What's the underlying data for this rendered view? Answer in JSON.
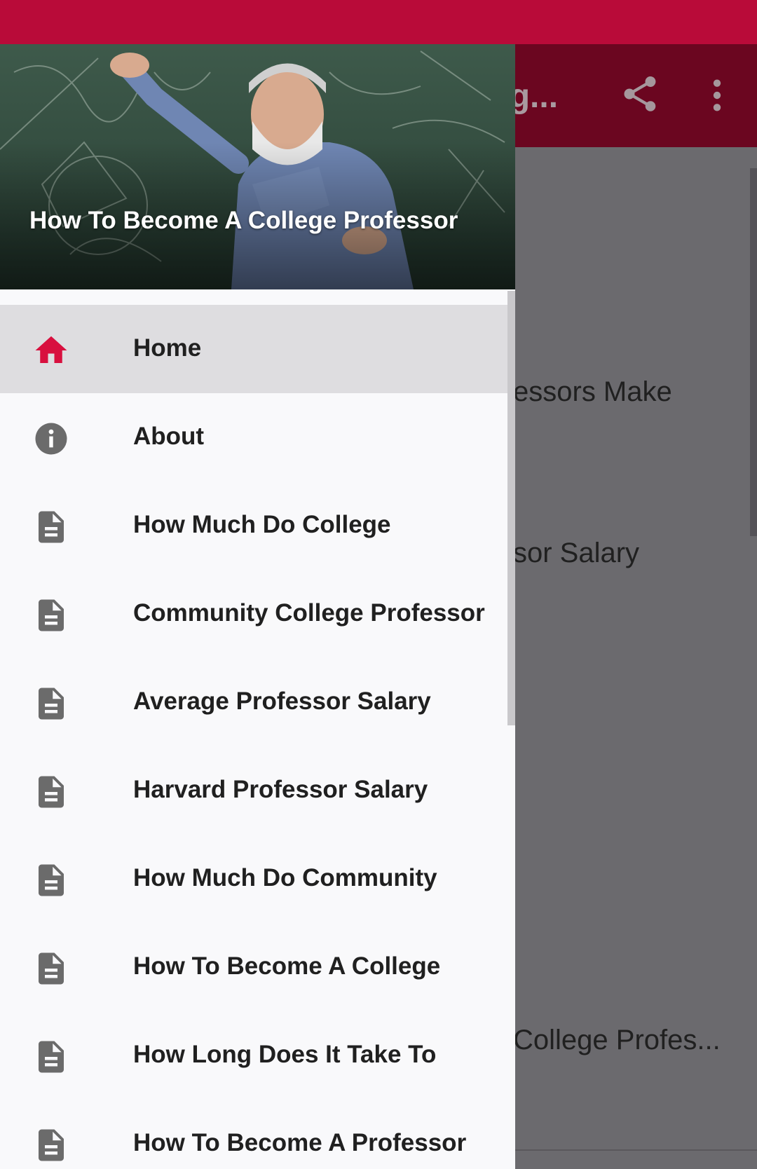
{
  "app_bar": {
    "title": "eg...",
    "icons": [
      "share-icon",
      "more-vert-icon"
    ]
  },
  "background_content": {
    "items": [
      "essors Make",
      "sor Salary",
      "College Profes..."
    ]
  },
  "drawer": {
    "header_title": "How To Become A College Professor",
    "items": [
      {
        "label": "Home",
        "icon": "home-icon",
        "selected": true
      },
      {
        "label": "About",
        "icon": "info-icon"
      },
      {
        "label": "How Much Do College",
        "icon": "document-icon"
      },
      {
        "label": "Community College Professor",
        "icon": "document-icon"
      },
      {
        "label": "Average Professor Salary",
        "icon": "document-icon"
      },
      {
        "label": "Harvard Professor Salary",
        "icon": "document-icon"
      },
      {
        "label": "How Much Do Community",
        "icon": "document-icon"
      },
      {
        "label": "How To Become A College",
        "icon": "document-icon"
      },
      {
        "label": "How Long Does It Take To",
        "icon": "document-icon"
      },
      {
        "label": "How To Become A Professor",
        "icon": "document-icon"
      }
    ]
  },
  "colors": {
    "status_bar": "#b90b39",
    "accent": "#d8103f",
    "drawer_bg": "#f9f9fb",
    "selected_bg": "#dedde0",
    "icon_gray": "#6b6b6b"
  }
}
